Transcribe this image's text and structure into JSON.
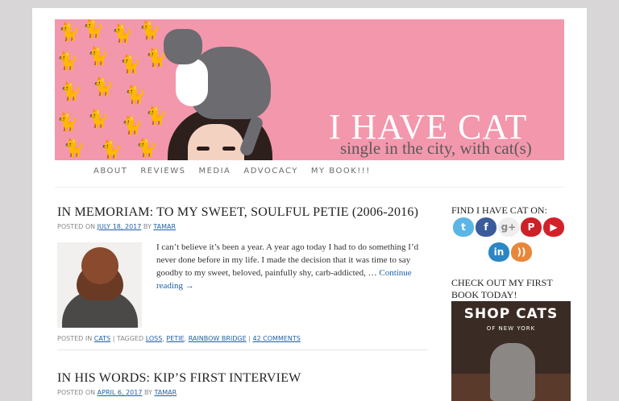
{
  "site": {
    "title": "I HAVE CAT",
    "tagline": "single in the city, with cat(s)"
  },
  "nav": [
    "ABOUT",
    "REVIEWS",
    "MEDIA",
    "ADVOCACY",
    "MY BOOK!!!"
  ],
  "posts": [
    {
      "title": "IN MEMORIAM: TO MY SWEET, SOULFUL PETIE (2006-2016)",
      "posted_on_label": "POSTED ON",
      "date": "JULY 18, 2017",
      "by_label": "BY",
      "author": "TAMAR",
      "excerpt": "I can’t believe it’s been a year. A year ago today I had to do something I’d never done before in my life. I made the decision that it was time to say goodby to my sweet, beloved, painfully shy, carb-addicted, …",
      "continue": "Continue reading →",
      "posted_in_label": "POSTED IN",
      "category": "CATS",
      "tagged_label": "| TAGGED",
      "tags": [
        "LOSS",
        "PETIE",
        "RAINBOW BRIDGE"
      ],
      "comments": "42 COMMENTS"
    },
    {
      "title": "IN HIS WORDS: KIP’S FIRST INTERVIEW",
      "posted_on_label": "POSTED ON",
      "date": "APRIL 6, 2017",
      "by_label": "BY",
      "author": "TAMAR"
    }
  ],
  "sidebar": {
    "find_heading": "FIND I HAVE CAT ON:",
    "social": [
      {
        "name": "twitter-icon",
        "glyph": "t",
        "color": "#5bb6e6"
      },
      {
        "name": "facebook-icon",
        "glyph": "f",
        "color": "#3b5b9a"
      },
      {
        "name": "google-plus-icon",
        "glyph": "g+",
        "color": "#eeeeee"
      },
      {
        "name": "pinterest-icon",
        "glyph": "P",
        "color": "#cc2127"
      },
      {
        "name": "youtube-icon",
        "glyph": "▶",
        "color": "#d4202a"
      },
      {
        "name": "linkedin-icon",
        "glyph": "in",
        "color": "#2a86c4"
      },
      {
        "name": "rss-icon",
        "glyph": "))",
        "color": "#e8873a"
      }
    ],
    "book_heading": "CHECK OUT MY FIRST BOOK TODAY!",
    "book_title": "SHOP CATS",
    "book_subtitle": "OF NEW YORK"
  }
}
